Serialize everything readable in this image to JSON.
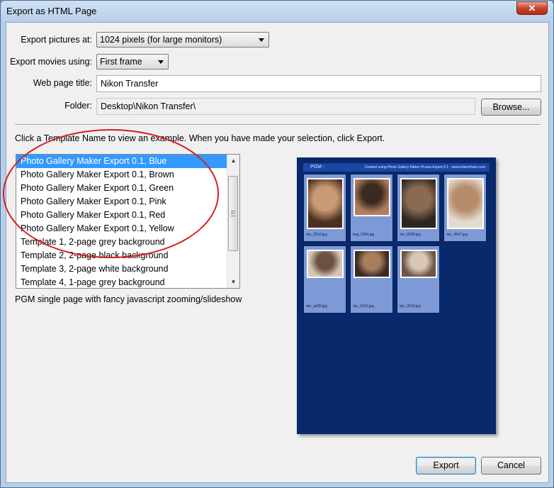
{
  "window": {
    "title": "Export as HTML Page",
    "close_glyph": "✕"
  },
  "form": {
    "export_pictures_label": "Export pictures at:",
    "export_pictures_value": "1024 pixels (for large monitors)",
    "export_movies_label": "Export movies using:",
    "export_movies_value": "First frame",
    "web_title_label": "Web page title:",
    "web_title_value": "Nikon Transfer",
    "folder_label": "Folder:",
    "folder_value": "Desktop\\Nikon Transfer\\",
    "browse_label": "Browse..."
  },
  "instructions": "Click a Template Name to view an example.  When you have made your selection, click Export.",
  "templates": {
    "selected_index": 0,
    "items": [
      "Photo Gallery Maker Export 0.1, Blue",
      "Photo Gallery Maker Export 0.1, Brown",
      "Photo Gallery Maker Export 0.1, Green",
      "Photo Gallery Maker Export 0.1, Pink",
      "Photo Gallery Maker Export 0.1, Red",
      "Photo Gallery Maker Export 0.1, Yellow",
      "Template 1, 2-page grey background",
      "Template 2, 2-page black background",
      "Template 3, 2-page white background",
      "Template 4, 1-page grey background"
    ]
  },
  "description": "PGM single page with fancy javascript zooming/slideshow",
  "preview": {
    "title": "PGM -",
    "credit": "Created using Photo Gallery Maker Picasa Export 0.1 - www.kdarrichars.com",
    "thumbnails": [
      {
        "caption": "dsc_0910.jpg",
        "colors": [
          "#c99a74",
          "#4b3020"
        ]
      },
      {
        "caption": "bog_0284.jpg",
        "colors": [
          "#3a2a22",
          "#b27d5c"
        ]
      },
      {
        "caption": "dsc_8058.jpg",
        "colors": [
          "#8a6a52",
          "#2d2520"
        ]
      },
      {
        "caption": "dsc_4647.jpg",
        "colors": [
          "#b68c6a",
          "#e4dbd0"
        ]
      },
      {
        "caption": "dsc_ad35.jpg",
        "colors": [
          "#6b5140",
          "#d4c7ba"
        ]
      },
      {
        "caption": "dsc_0023.jpg",
        "colors": [
          "#a97e5e",
          "#3a2c24"
        ]
      },
      {
        "caption": "dsc_0019.jpg",
        "colors": [
          "#d9c7b5",
          "#6e5443"
        ]
      }
    ]
  },
  "buttons": {
    "export": "Export",
    "cancel": "Cancel"
  },
  "scrollbar": {
    "up": "▲",
    "down": "▼"
  }
}
